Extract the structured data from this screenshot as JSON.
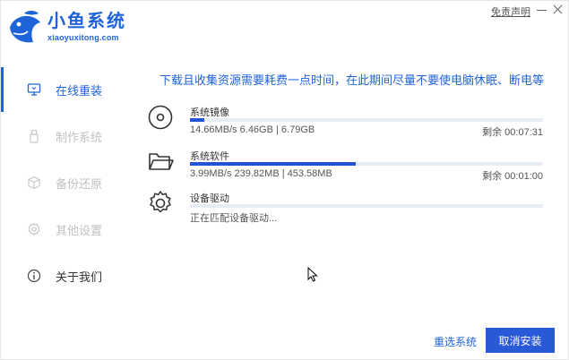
{
  "header": {
    "logo_cn": "小鱼系统",
    "logo_en": "xiaoyuxitong.com",
    "disclaimer": "免责声明"
  },
  "sidebar": {
    "items": [
      {
        "label": "在线重装",
        "icon": "monitor-icon",
        "state": "active"
      },
      {
        "label": "制作系统",
        "icon": "usb-drive-icon",
        "state": "disabled"
      },
      {
        "label": "备份还原",
        "icon": "cube-icon",
        "state": "disabled"
      },
      {
        "label": "其他设置",
        "icon": "gear-icon",
        "state": "disabled"
      },
      {
        "label": "关于我们",
        "icon": "info-icon",
        "state": "enabled"
      }
    ]
  },
  "main": {
    "notice": "下载且收集资源需要耗费一点时间，在此期间尽量不要使电脑休眠、断电等",
    "tasks": [
      {
        "name": "系统镜像",
        "icon": "disc-icon",
        "stats": "14.66MB/s 6.46GB | 6.79GB",
        "time": "剩余 00:07:31",
        "progress": 0.04
      },
      {
        "name": "系统软件",
        "icon": "folder-icon",
        "stats": "3.99MB/s 239.82MB | 453.58MB",
        "time": "剩余 00:01:00",
        "progress": 0.47
      },
      {
        "name": "设备驱动",
        "icon": "gear-icon",
        "stats": "正在匹配设备驱动...",
        "time": "",
        "progress": 0
      }
    ]
  },
  "actions": {
    "reselect": "重选系统",
    "cancel": "取消安装"
  },
  "colors": {
    "accent": "#1f63d8",
    "progress": "#2254d4",
    "track": "#e8edf5"
  }
}
